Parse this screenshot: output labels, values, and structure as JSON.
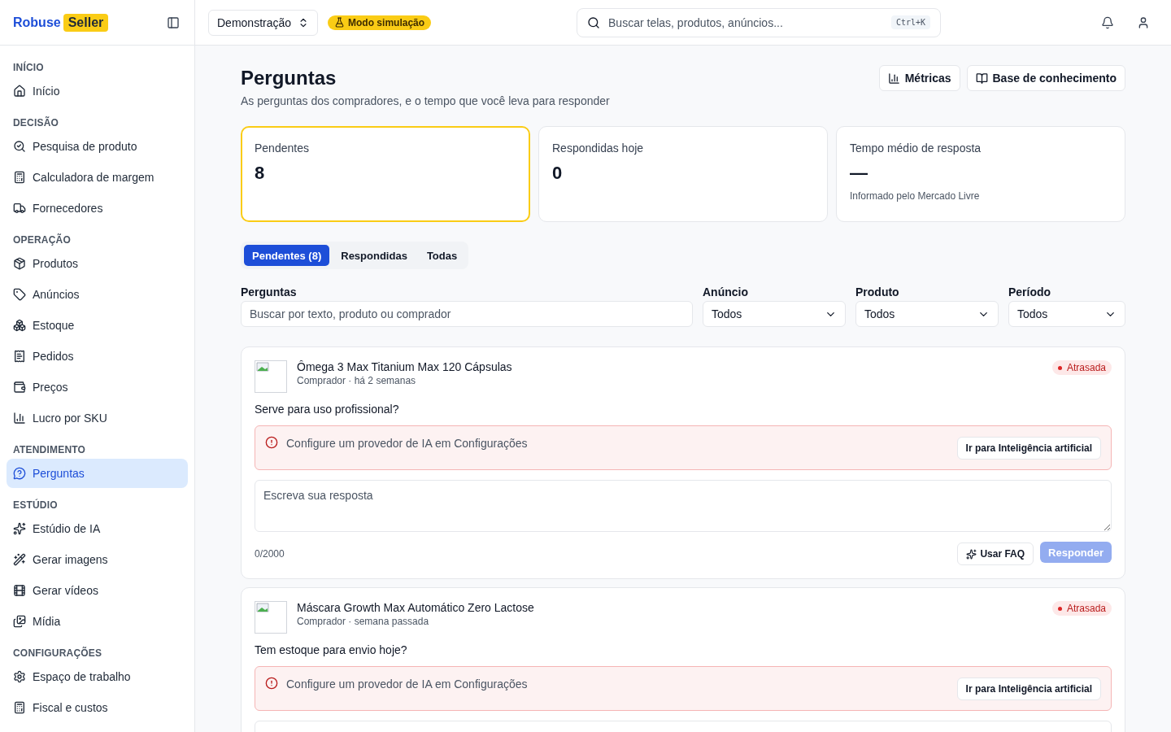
{
  "brand": {
    "name": "Robuse",
    "badge": "Seller"
  },
  "topbar": {
    "workspace": "Demonstração",
    "mode_badge": "Modo simulação",
    "search": {
      "placeholder": "Buscar telas, produtos, anúncios...",
      "shortcut": "Ctrl+K"
    }
  },
  "sidebar": {
    "sections": [
      {
        "title": "INÍCIO",
        "items": [
          {
            "label": "Início",
            "selected": false
          }
        ]
      },
      {
        "title": "DECISÃO",
        "items": [
          {
            "label": "Pesquisa de produto",
            "selected": false
          },
          {
            "label": "Calculadora de margem",
            "selected": false
          },
          {
            "label": "Fornecedores",
            "selected": false
          }
        ]
      },
      {
        "title": "OPERAÇÃO",
        "items": [
          {
            "label": "Produtos",
            "selected": false
          },
          {
            "label": "Anúncios",
            "selected": false
          },
          {
            "label": "Estoque",
            "selected": false
          },
          {
            "label": "Pedidos",
            "selected": false
          },
          {
            "label": "Preços",
            "selected": false
          },
          {
            "label": "Lucro por SKU",
            "selected": false
          }
        ]
      },
      {
        "title": "ATENDIMENTO",
        "items": [
          {
            "label": "Perguntas",
            "selected": true
          }
        ]
      },
      {
        "title": "ESTÚDIO",
        "items": [
          {
            "label": "Estúdio de IA",
            "selected": false
          },
          {
            "label": "Gerar imagens",
            "selected": false
          },
          {
            "label": "Gerar vídeos",
            "selected": false
          },
          {
            "label": "Mídia",
            "selected": false
          }
        ]
      },
      {
        "title": "CONFIGURAÇÕES",
        "items": [
          {
            "label": "Espaço de trabalho",
            "selected": false
          },
          {
            "label": "Fiscal e custos",
            "selected": false
          }
        ]
      }
    ]
  },
  "page": {
    "title": "Perguntas",
    "subtitle": "As perguntas dos compradores, e o tempo que você leva para responder",
    "actions": [
      "Métricas",
      "Base de conhecimento"
    ]
  },
  "stats": [
    {
      "label": "Pendentes",
      "value": "8",
      "selected": true
    },
    {
      "label": "Respondidas hoje",
      "value": "0",
      "selected": false
    },
    {
      "label": "Tempo médio de resposta",
      "value": "—",
      "note": "Informado pelo Mercado Livre",
      "selected": false
    }
  ],
  "tabs": [
    {
      "label": "Pendentes (8)",
      "selected": true
    },
    {
      "label": "Respondidas",
      "selected": false
    },
    {
      "label": "Todas",
      "selected": false
    }
  ],
  "filters": {
    "search": {
      "label": "Perguntas",
      "placeholder": "Buscar por texto, produto ou comprador"
    },
    "selects": [
      {
        "label": "Anúncio",
        "value": "Todos"
      },
      {
        "label": "Produto",
        "value": "Todos"
      },
      {
        "label": "Período",
        "value": "Todos"
      }
    ]
  },
  "questions": [
    {
      "product": "Ômega 3 Max Titanium Max 120 Cápsulas",
      "meta": "Comprador · há 2 semanas",
      "status": "Atrasada",
      "question": "Serve para uso profissional?",
      "alert": "Configure um provedor de IA em Configurações",
      "alert_action": "Ir para Inteligência artificial",
      "reply_placeholder": "Escreva sua resposta",
      "counter": "0/2000",
      "faq_button": "Usar FAQ",
      "submit_button": "Responder"
    },
    {
      "product": "Máscara Growth Max Automático Zero Lactose",
      "meta": "Comprador · semana passada",
      "status": "Atrasada",
      "question": "Tem estoque para envio hoje?",
      "alert": "Configure um provedor de IA em Configurações",
      "alert_action": "Ir para Inteligência artificial"
    }
  ]
}
